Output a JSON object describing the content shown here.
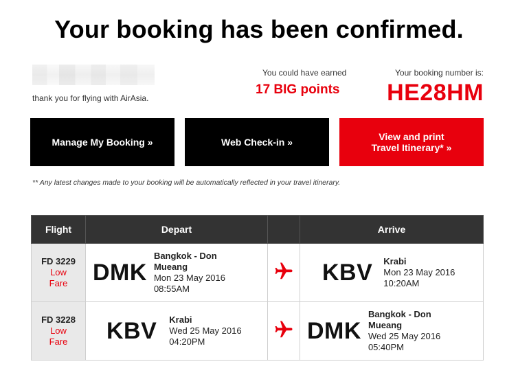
{
  "header": {
    "title": "Your booking has been confirmed.",
    "thanks": "thank you for flying with AirAsia."
  },
  "points": {
    "label": "You could have earned",
    "value": "17 BIG points"
  },
  "booking": {
    "label": "Your booking number is:",
    "number": "HE28HM"
  },
  "buttons": {
    "manage": "Manage My Booking »",
    "checkin": "Web Check-in »",
    "itinerary_line1": "View and print",
    "itinerary_line2": "Travel Itinerary* »"
  },
  "note": "** Any latest changes made to your booking will be automatically reflected in your travel itinerary.",
  "table": {
    "headers": {
      "flight": "Flight",
      "depart": "Depart",
      "arrive": "Arrive"
    },
    "rows": [
      {
        "flight_no": "FD 3229",
        "fare_line1": "Low",
        "fare_line2": "Fare",
        "depart_code": "DMK",
        "depart_city_line1": "Bangkok - Don",
        "depart_city_line2": "Mueang",
        "depart_date": "Mon 23 May 2016",
        "depart_time": "08:55AM",
        "arrive_code": "KBV",
        "arrive_city_line1": "Krabi",
        "arrive_city_line2": "",
        "arrive_date": "Mon 23 May 2016",
        "arrive_time": "10:20AM"
      },
      {
        "flight_no": "FD 3228",
        "fare_line1": "Low",
        "fare_line2": "Fare",
        "depart_code": "KBV",
        "depart_city_line1": "Krabi",
        "depart_city_line2": "",
        "depart_date": "Wed 25 May 2016",
        "depart_time": "04:20PM",
        "arrive_code": "DMK",
        "arrive_city_line1": "Bangkok - Don",
        "arrive_city_line2": "Mueang",
        "arrive_date": "Wed 25 May 2016",
        "arrive_time": "05:40PM"
      }
    ]
  },
  "icons": {
    "plane": "airplane-icon"
  },
  "colors": {
    "brand_red": "#e8000d",
    "header_dark": "#333333",
    "button_black": "#000000"
  }
}
